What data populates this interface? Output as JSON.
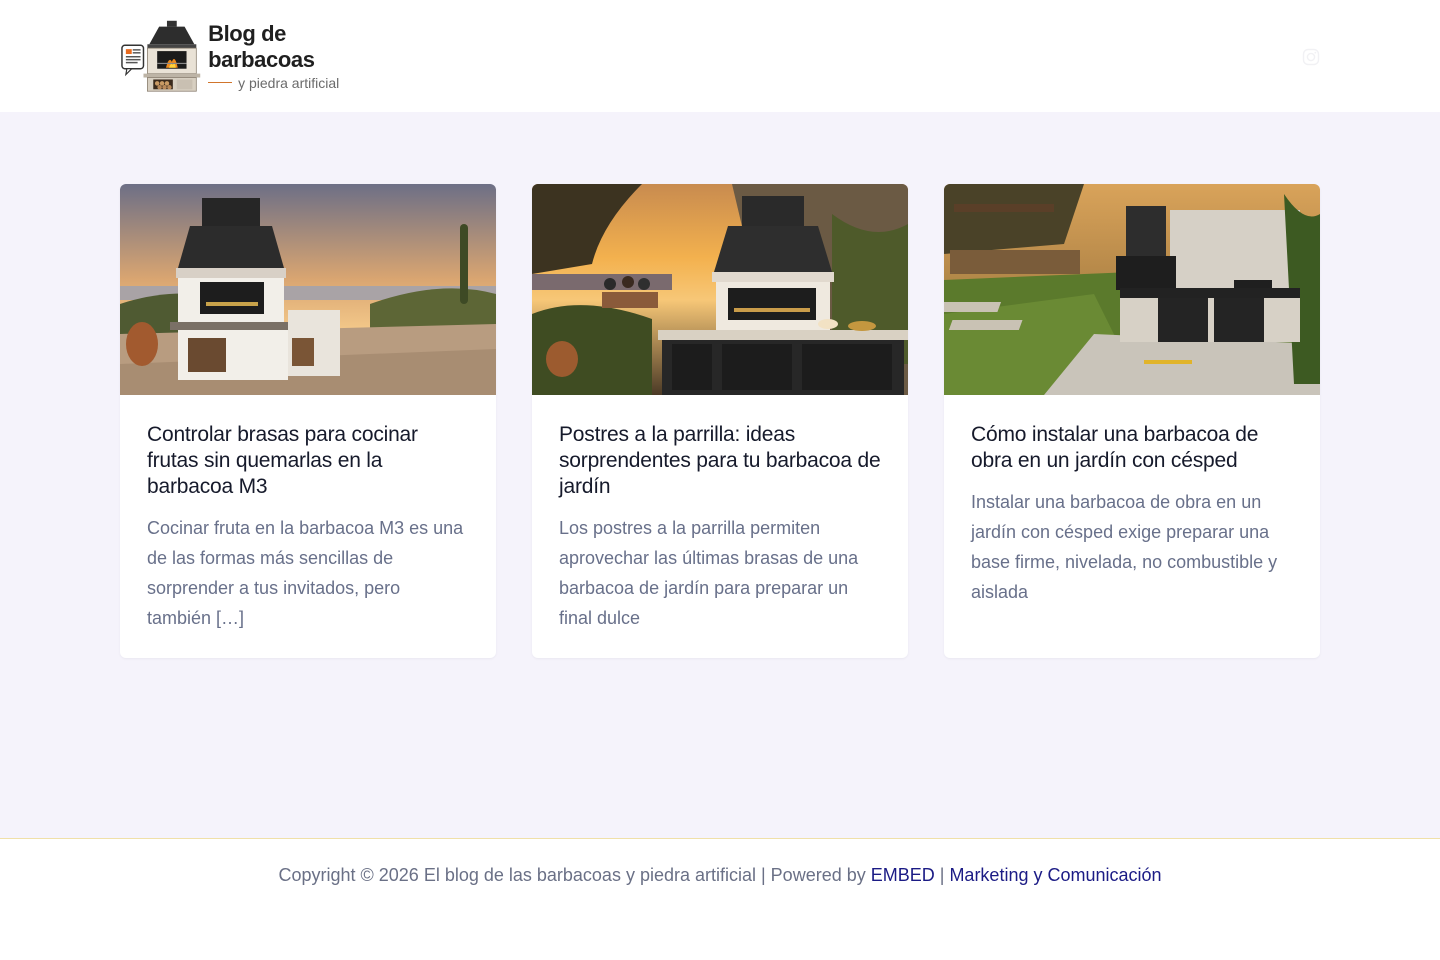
{
  "header": {
    "logo_title": "Blog de barbacoas",
    "logo_subtitle": "y piedra artificial",
    "instagram_icon": "instagram-icon"
  },
  "posts": [
    {
      "title": "Controlar brasas para cocinar frutas sin quemarlas en la barbacoa M3",
      "excerpt": "Cocinar fruta en la barbacoa M3 es una de las formas más sencillas de sorprender a tus invitados, pero también […]"
    },
    {
      "title": "Postres a la parrilla: ideas sorprendentes para tu barbacoa de jardín",
      "excerpt": "Los postres a la parrilla permiten aprovechar las últimas brasas de una barbacoa de jardín para preparar un final dulce"
    },
    {
      "title": "Cómo instalar una barbacoa de obra en un jardín con césped",
      "excerpt": "Instalar una barbacoa de obra en un jardín con césped exige preparar una base firme, nivelada, no combustible y aislada"
    }
  ],
  "footer": {
    "copyright": "Copyright © 2026 El blog de las barbacoas y piedra artificial | Powered by ",
    "link1": "EMBED",
    "separator": " | ",
    "link2": "Marketing y Comunicación"
  },
  "colors": {
    "background": "#f5f3fb",
    "card": "#ffffff",
    "title": "#161a2b",
    "excerpt": "#68708a",
    "footer_link": "#1b1b85",
    "footer_border": "#f0e0a8"
  }
}
